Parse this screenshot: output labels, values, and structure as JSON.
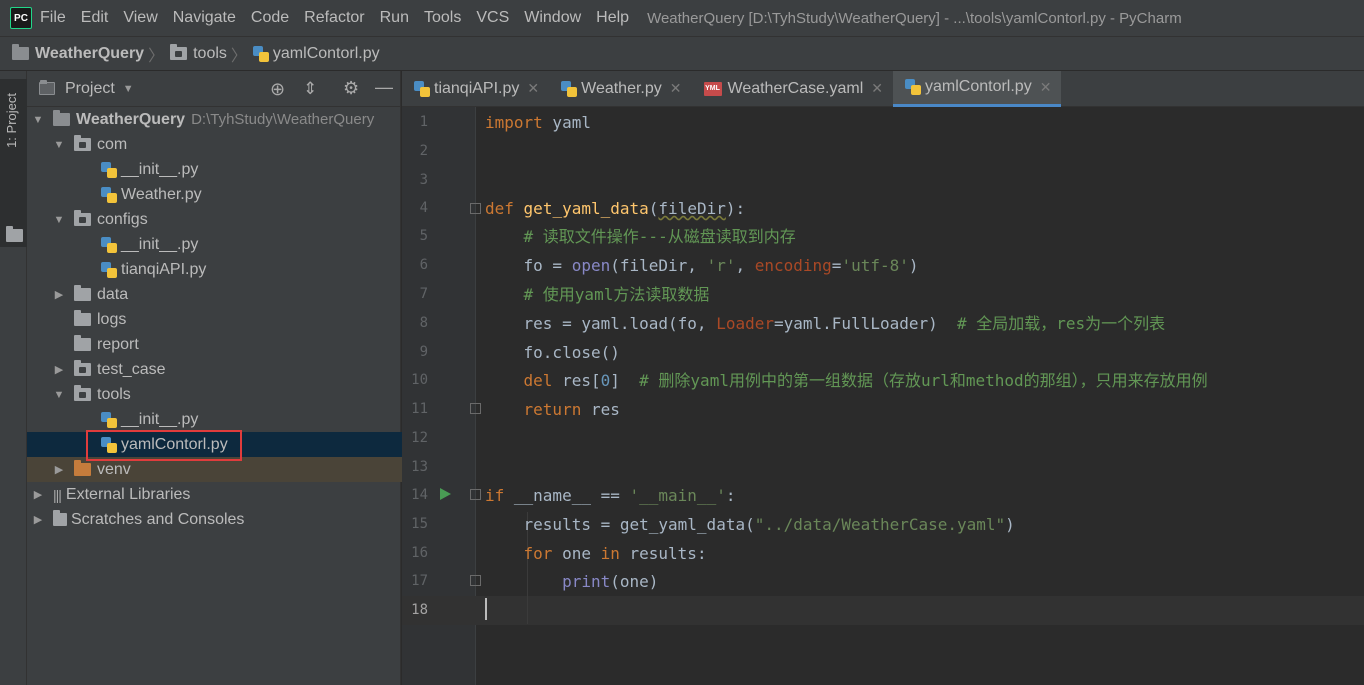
{
  "menubar": {
    "logo": "PC",
    "items": [
      "File",
      "Edit",
      "View",
      "Navigate",
      "Code",
      "Refactor",
      "Run",
      "Tools",
      "VCS",
      "Window",
      "Help"
    ],
    "title": "WeatherQuery [D:\\TyhStudy\\WeatherQuery] - ...\\tools\\yamlContorl.py - PyCharm"
  },
  "breadcrumb": {
    "project": "WeatherQuery",
    "folder": "tools",
    "file": "yamlContorl.py"
  },
  "sidebar_strip": {
    "label": "1: Project"
  },
  "project_panel": {
    "title": "Project",
    "root": {
      "name": "WeatherQuery",
      "path": "D:\\TyhStudy\\WeatherQuery"
    },
    "items": [
      {
        "label": "com"
      },
      {
        "label": "__init__.py"
      },
      {
        "label": "Weather.py"
      },
      {
        "label": "configs"
      },
      {
        "label": "__init__.py"
      },
      {
        "label": "tianqiAPI.py"
      },
      {
        "label": "data"
      },
      {
        "label": "logs"
      },
      {
        "label": "report"
      },
      {
        "label": "test_case"
      },
      {
        "label": "tools"
      },
      {
        "label": "__init__.py"
      },
      {
        "label": "yamlContorl.py"
      },
      {
        "label": "venv"
      },
      {
        "label": "External Libraries"
      },
      {
        "label": "Scratches and Consoles"
      }
    ]
  },
  "editor_tabs": [
    {
      "label": "tianqiAPI.py"
    },
    {
      "label": "Weather.py"
    },
    {
      "label": "WeatherCase.yaml"
    },
    {
      "label": "yamlContorl.py"
    }
  ],
  "line_numbers": [
    "1",
    "2",
    "3",
    "4",
    "5",
    "6",
    "7",
    "8",
    "9",
    "10",
    "11",
    "12",
    "13",
    "14",
    "15",
    "16",
    "17",
    "18"
  ],
  "code": {
    "import_kw": "import",
    "import_mod": " yaml",
    "def_kw": "def",
    "func_name": "get_yaml_data",
    "func_param": "fileDir",
    "comment5": "# 读取文件操作---从磁盘读取到内存",
    "l6_a": "fo = ",
    "l6_open": "open",
    "l6_b": "(fileDir, ",
    "l6_s1": "'r'",
    "l6_c": ", ",
    "l6_kw": "encoding",
    "l6_d": "=",
    "l6_s2": "'utf-8'",
    "l6_e": ")",
    "comment7": "# 使用yaml方法读取数据",
    "l8_a": "res = yaml.load(fo, ",
    "l8_kw": "Loader",
    "l8_b": "=yaml.FullLoader)  ",
    "l8_comment": "# 全局加载，res为一个列表",
    "l9": "fo.close()",
    "l10_del": "del",
    "l10_a": " res[",
    "l10_num": "0",
    "l10_b": "]  ",
    "l10_comment": "# 删除yaml用例中的第一组数据（存放url和method的那组），只用来存放用例",
    "l11_ret": "return",
    "l11_a": " res",
    "l14_if": "if",
    "l14_a": " __name__ == ",
    "l14_s": "'__main__'",
    "l14_b": ":",
    "l15_a": "results = get_yaml_data(",
    "l15_s": "\"../data/WeatherCase.yaml\"",
    "l15_b": ")",
    "l16_for": "for",
    "l16_a": " one ",
    "l16_in": "in",
    "l16_b": " results:",
    "l17_print": "print",
    "l17_a": "(one)"
  }
}
